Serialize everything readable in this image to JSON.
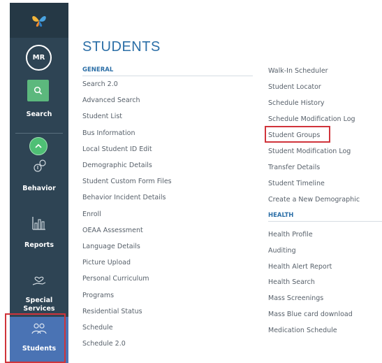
{
  "sidebar": {
    "avatar_initials": "MR",
    "items": [
      {
        "label": "Search",
        "icon": "search-icon"
      },
      {
        "label": "Behavior",
        "icon": "behavior-icon"
      },
      {
        "label": "Reports",
        "icon": "bar-chart-icon"
      },
      {
        "label": "Special",
        "label2": "Services",
        "icon": "hand-heart-icon"
      },
      {
        "label": "Students",
        "icon": "students-icon"
      }
    ]
  },
  "page": {
    "title": "STUDENTS"
  },
  "general": {
    "heading": "GENERAL",
    "items": [
      "Search 2.0",
      "Advanced Search",
      "Student List",
      "Bus Information",
      "Local Student ID Edit",
      "Demographic Details",
      "Student Custom Form Files",
      "Behavior Incident Details",
      "Enroll",
      "OEAA Assessment",
      "Language Details",
      "Picture Upload",
      "Personal Curriculum",
      "Programs",
      "Residential Status",
      "Schedule",
      "Schedule 2.0"
    ]
  },
  "right": {
    "items": [
      "Walk-In Scheduler",
      "Student Locator",
      "Schedule History",
      "Schedule Modification Log",
      "Student Groups",
      "Student Modification Log",
      "Transfer Details",
      "Student Timeline",
      "Create a New Demographic"
    ]
  },
  "health": {
    "heading": "HEALTH",
    "items": [
      "Health Profile",
      "Auditing",
      "Health Alert Report",
      "Health Search",
      "Mass Screenings",
      "Mass Blue card download",
      "Medication Schedule"
    ]
  },
  "colors": {
    "sidebar": "#2e4454",
    "accent": "#2c6fa7",
    "active": "#4a73b4",
    "highlight": "#d0343b"
  }
}
